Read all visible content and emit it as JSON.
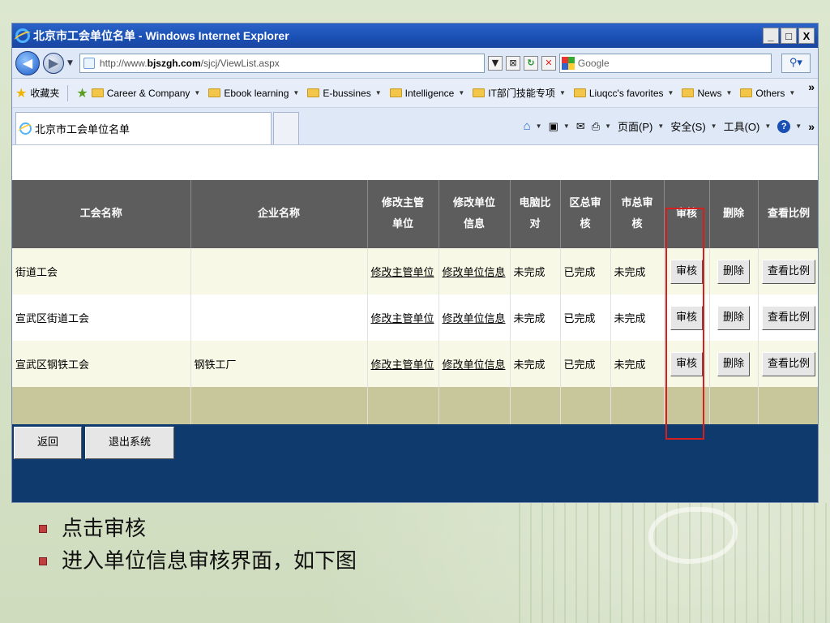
{
  "browser": {
    "window_title": "北京市工会单位名单 - Windows Internet Explorer",
    "window_buttons": [
      "_",
      "□",
      "X"
    ],
    "url_parts": {
      "prefix": "http://www.",
      "domain": "bjszgh.com",
      "path": "/sjcj/ViewList.aspx"
    },
    "search_placeholder": "Google",
    "favorites_label": "收藏夹",
    "favorites": [
      "Career & Company",
      "Ebook learning",
      "E-bussines",
      "Intelligence",
      "IT部门技能专项",
      "Liuqcc's favorites",
      "News",
      "Others"
    ],
    "tab_title": "北京市工会单位名单",
    "commands": {
      "page": "页面(P)",
      "safety": "安全(S)",
      "tools": "工具(O)"
    },
    "chevrons": "»"
  },
  "table": {
    "headers": [
      "工会名称",
      "企业名称",
      "修改主管单位",
      "修改单位信息",
      "电脑比对",
      "区总审核",
      "市总审核",
      "审核",
      "删除",
      "查看比例"
    ],
    "rows": [
      {
        "union": "街道工会",
        "company": "",
        "edit_supervisor": "修改主管单位",
        "edit_info": "修改单位信息",
        "compare": "未完成",
        "district_review": "已完成",
        "city_review": "未完成",
        "review_btn": "审核",
        "delete_btn": "删除",
        "ratio_btn": "查看比例"
      },
      {
        "union": "宣武区街道工会",
        "company": "",
        "edit_supervisor": "修改主管单位",
        "edit_info": "修改单位信息",
        "compare": "未完成",
        "district_review": "已完成",
        "city_review": "未完成",
        "review_btn": "审核",
        "delete_btn": "删除",
        "ratio_btn": "查看比例"
      },
      {
        "union": "宣武区钢铁工会",
        "company": "钢铁工厂",
        "edit_supervisor": "修改主管单位",
        "edit_info": "修改单位信息",
        "compare": "未完成",
        "district_review": "已完成",
        "city_review": "未完成",
        "review_btn": "审核",
        "delete_btn": "删除",
        "ratio_btn": "查看比例"
      }
    ]
  },
  "footer_buttons": {
    "back": "返回",
    "exit": "退出系统"
  },
  "slide_bullets": [
    "点击审核",
    "进入单位信息审核界面，如下图"
  ],
  "colors": {
    "titlebar": "#1a4fb3",
    "header_bg": "#5d5d5d",
    "content_bg": "#0e3a6e",
    "highlight": "#d62020",
    "row_alt": "#f8f8e6",
    "blank_row": "#c8c79b"
  }
}
